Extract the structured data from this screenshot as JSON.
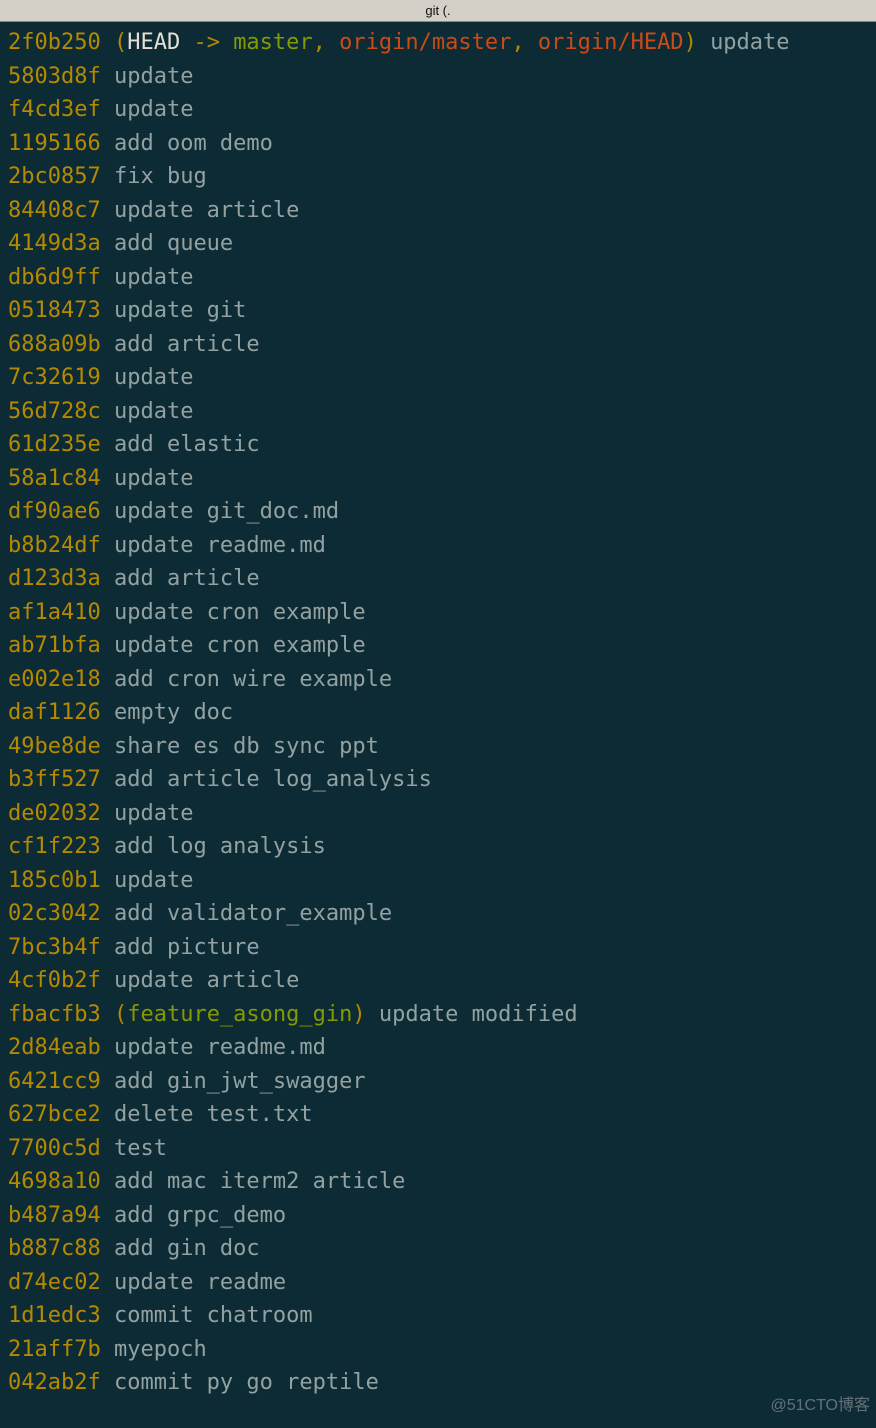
{
  "title_bar": "git (.",
  "watermark": "@51CTO博客",
  "head_label": "HEAD",
  "arrow": " -> ",
  "commits": [
    {
      "hash": "2f0b250",
      "refs": {
        "head": true,
        "target": "master",
        "remotes": [
          "origin/master",
          "origin/HEAD"
        ]
      },
      "msg": "update"
    },
    {
      "hash": "5803d8f",
      "msg": "update"
    },
    {
      "hash": "f4cd3ef",
      "msg": "update"
    },
    {
      "hash": "1195166",
      "msg": "add oom demo"
    },
    {
      "hash": "2bc0857",
      "msg": "fix bug"
    },
    {
      "hash": "84408c7",
      "msg": "update article"
    },
    {
      "hash": "4149d3a",
      "msg": "add queue"
    },
    {
      "hash": "db6d9ff",
      "msg": "update"
    },
    {
      "hash": "0518473",
      "msg": "update git"
    },
    {
      "hash": "688a09b",
      "msg": "add article"
    },
    {
      "hash": "7c32619",
      "msg": "update"
    },
    {
      "hash": "56d728c",
      "msg": "update"
    },
    {
      "hash": "61d235e",
      "msg": "add elastic"
    },
    {
      "hash": "58a1c84",
      "msg": "update"
    },
    {
      "hash": "df90ae6",
      "msg": "update git_doc.md"
    },
    {
      "hash": "b8b24df",
      "msg": "update readme.md"
    },
    {
      "hash": "d123d3a",
      "msg": "add article"
    },
    {
      "hash": "af1a410",
      "msg": "update cron example"
    },
    {
      "hash": "ab71bfa",
      "msg": "update cron example"
    },
    {
      "hash": "e002e18",
      "msg": "add cron wire example"
    },
    {
      "hash": "daf1126",
      "msg": "empty doc"
    },
    {
      "hash": "49be8de",
      "msg": "share es db sync ppt"
    },
    {
      "hash": "b3ff527",
      "msg": "add article log_analysis"
    },
    {
      "hash": "de02032",
      "msg": "update"
    },
    {
      "hash": "cf1f223",
      "msg": "add log analysis"
    },
    {
      "hash": "185c0b1",
      "msg": "update"
    },
    {
      "hash": "02c3042",
      "msg": "add validator_example"
    },
    {
      "hash": "7bc3b4f",
      "msg": "add picture"
    },
    {
      "hash": "4cf0b2f",
      "msg": "update article"
    },
    {
      "hash": "fbacfb3",
      "refs": {
        "local": "feature_asong_gin"
      },
      "msg": "update modified"
    },
    {
      "hash": "2d84eab",
      "msg": "update readme.md"
    },
    {
      "hash": "6421cc9",
      "msg": "add gin_jwt_swagger"
    },
    {
      "hash": "627bce2",
      "msg": "delete test.txt"
    },
    {
      "hash": "7700c5d",
      "msg": "test"
    },
    {
      "hash": "4698a10",
      "msg": "add mac iterm2 article"
    },
    {
      "hash": "b487a94",
      "msg": "add grpc_demo"
    },
    {
      "hash": "b887c88",
      "msg": "add gin doc"
    },
    {
      "hash": "d74ec02",
      "msg": "update readme"
    },
    {
      "hash": "1d1edc3",
      "msg": "commit chatroom"
    },
    {
      "hash": "21aff7b",
      "msg": "myepoch"
    },
    {
      "hash": "042ab2f",
      "msg": "commit py go reptile"
    }
  ]
}
